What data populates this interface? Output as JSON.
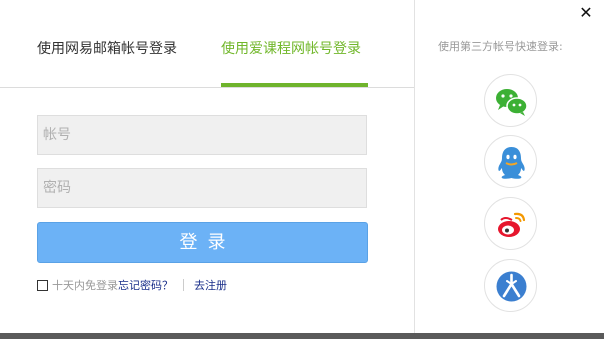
{
  "tabs": [
    {
      "label": "使用网易邮箱帐号登录",
      "active": false
    },
    {
      "label": "使用爱课程网帐号登录",
      "active": true
    }
  ],
  "form": {
    "account_placeholder": "帐号",
    "account_value": "",
    "password_placeholder": "密码",
    "password_value": "",
    "login_label": "登录",
    "remember_label": "十天内免登录",
    "remember_checked": false,
    "forgot_label": "忘记密码？",
    "register_label": "去注册"
  },
  "third_party": {
    "title": "使用第三方帐号快速登录:",
    "providers": [
      {
        "name": "wechat-icon",
        "color": "#3cb034"
      },
      {
        "name": "qq-icon",
        "color": "#3a8fd9"
      },
      {
        "name": "weibo-icon",
        "color": "#e6162d"
      },
      {
        "name": "renren-icon",
        "color": "#3b7fd0"
      }
    ]
  },
  "close_label": "✕",
  "colors": {
    "accent_green": "#6fb42c",
    "button_blue": "#6cb2f6",
    "link_blue": "#1a2f8a"
  }
}
